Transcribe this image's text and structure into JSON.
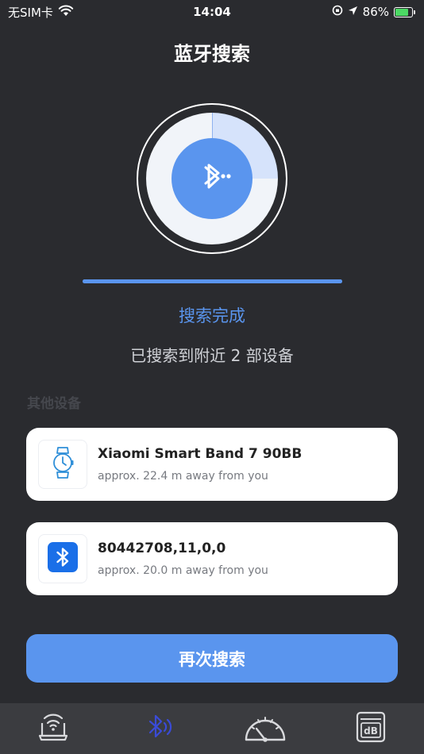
{
  "status_bar": {
    "carrier": "无SIM卡",
    "time": "14:04",
    "battery": "86%"
  },
  "page": {
    "title": "蓝牙搜索",
    "scan_status": "搜索完成",
    "summary": "已搜索到附近 2 部设备",
    "section_label": "其他设备",
    "search_again": "再次搜索"
  },
  "scan": {
    "progress_percent": 100
  },
  "devices": [
    {
      "name": "Xiaomi Smart Band 7 90BB",
      "distance": "approx. 22.4 m away from you",
      "icon": "watch-icon"
    },
    {
      "name": "80442708,11,0,0",
      "distance": "approx. 20.0 m away from you",
      "icon": "bluetooth-icon"
    }
  ],
  "tabs": [
    {
      "icon": "router-icon",
      "active": false
    },
    {
      "icon": "bluetooth-scan-icon",
      "active": true
    },
    {
      "icon": "speedometer-icon",
      "active": false
    },
    {
      "icon": "decibel-icon",
      "active": false
    }
  ],
  "colors": {
    "background": "#2a2b2f",
    "accent": "#5a95ee",
    "tab_bar": "#3b3c40",
    "card": "#ffffff",
    "active_tab": "#3a4bd6"
  }
}
